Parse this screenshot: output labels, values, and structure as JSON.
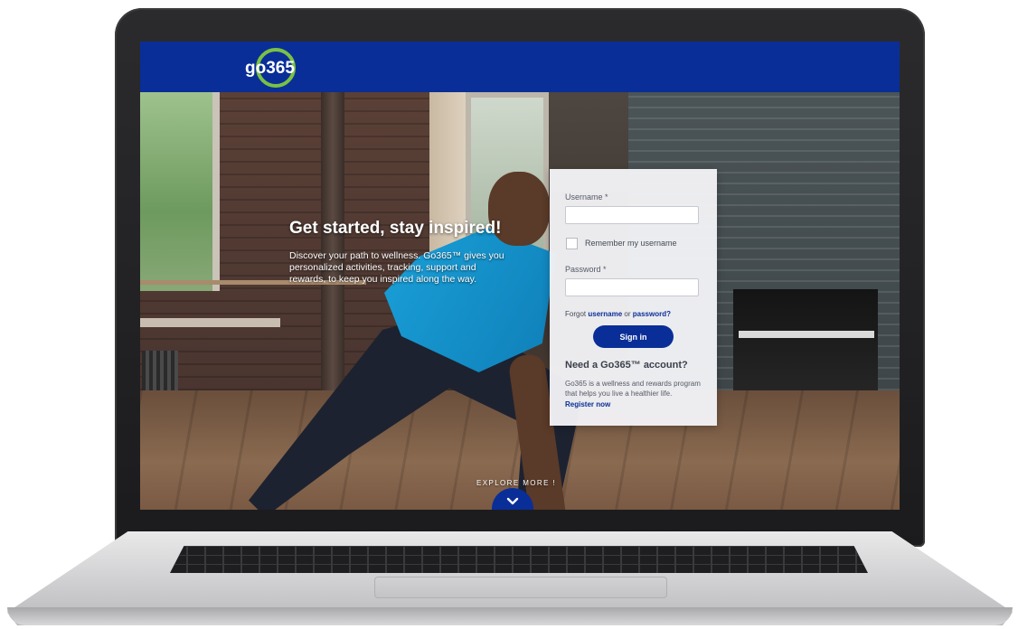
{
  "brand": {
    "logo_text": "go365",
    "primary_color": "#0a2e98",
    "accent_color": "#7ac143"
  },
  "hero": {
    "title": "Get started, stay inspired!",
    "description": "Discover your path to wellness. Go365™ gives you personalized activities, tracking, support and rewards, to keep you inspired along the way."
  },
  "login": {
    "username_label": "Username *",
    "username_value": "",
    "remember_label": "Remember my username",
    "remember_checked": false,
    "password_label": "Password *",
    "password_value": "",
    "forgot_prefix": "Forgot",
    "forgot_username": "username",
    "forgot_or": "or",
    "forgot_password": "password?",
    "signin_label": "Sign in",
    "need_account_title": "Need a Go365™ account?",
    "need_account_desc": "Go365 is a wellness and rewards program that helps you live a healthier life.",
    "register_label": "Register now"
  },
  "explore": {
    "label": "EXPLORE MORE !",
    "icon": "chevron-down-icon"
  }
}
